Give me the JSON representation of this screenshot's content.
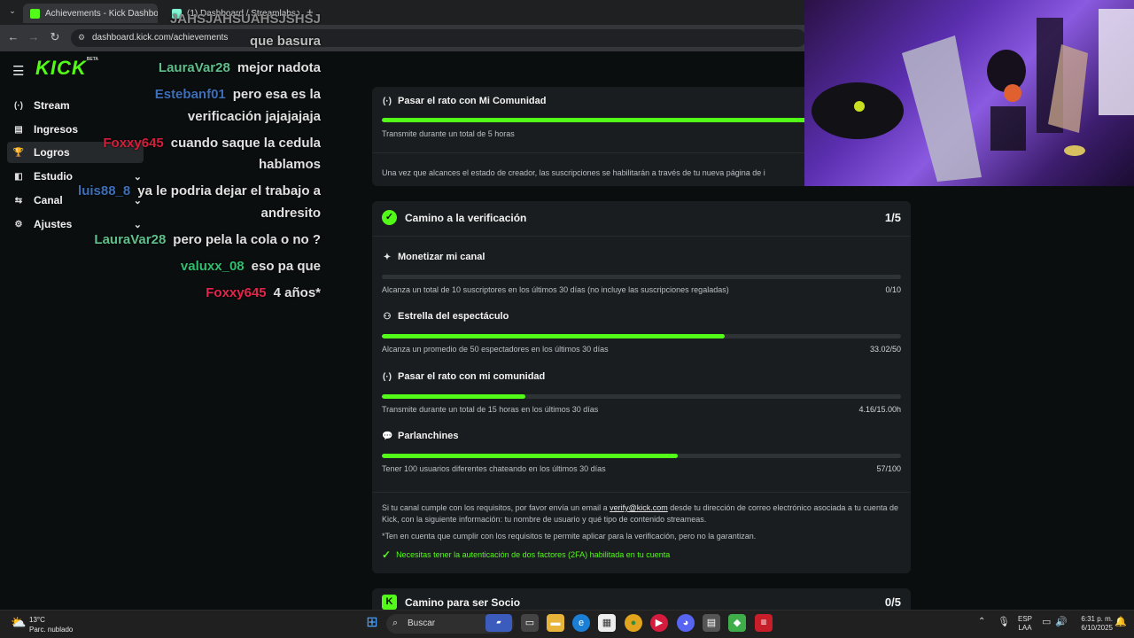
{
  "browser": {
    "tabs": [
      {
        "title": "Achievements - Kick Dashboard",
        "close": "✕"
      },
      {
        "title": "(1) Dashboard / Streamlabs",
        "close": "✕"
      }
    ],
    "new_tab": "+",
    "url": "dashboard.kick.com/achievements",
    "favicon_colors": {
      "kick": "#53fc18",
      "streamlabs": "#80f5d2"
    }
  },
  "sidebar": {
    "logo": "KICK",
    "logo_badge": "BETA",
    "items": [
      {
        "label": "Stream",
        "icon": "broadcast-icon",
        "glyph": "(·)"
      },
      {
        "label": "Ingresos",
        "icon": "wallet-icon",
        "glyph": "▤"
      },
      {
        "label": "Logros",
        "icon": "trophy-icon",
        "glyph": "🏆",
        "active": true
      },
      {
        "label": "Estudio",
        "icon": "studio-icon",
        "glyph": "◧",
        "expandable": true
      },
      {
        "label": "Canal",
        "icon": "channel-icon",
        "glyph": "⇆",
        "expandable": true
      },
      {
        "label": "Ajustes",
        "icon": "gear-icon",
        "glyph": "⚙",
        "expandable": true
      }
    ]
  },
  "chat": {
    "lines": [
      {
        "user": "",
        "msg": "JAHSJAHSUAHSJSHSJ",
        "color": "#8a8a8a"
      },
      {
        "user": "",
        "msg": "que basura",
        "color": "#bdbdbd"
      },
      {
        "user": "LauraVar28",
        "msg": "mejor nadota",
        "color": "#5fbf8a"
      },
      {
        "user": "Estebanf01",
        "msg": "pero esa es la",
        "color": "#3d6fb8"
      },
      {
        "user": "",
        "msg": "verificación jajajajaja",
        "color": "#e0e0e0"
      },
      {
        "user": "Foxxy645",
        "msg": "cuando saque la cedula",
        "color": "#d21f3c"
      },
      {
        "user": "",
        "msg": "hablamos",
        "color": "#e0e0e0"
      },
      {
        "user": "luis88_8",
        "msg": "ya le podria dejar el trabajo a",
        "color": "#3d6fb8"
      },
      {
        "user": "",
        "msg": "andresito",
        "color": "#e0e0e0"
      },
      {
        "user": "LauraVar28",
        "msg": "pero pela la cola o no ?",
        "color": "#5fbf8a"
      },
      {
        "user": "valuxx_08",
        "msg": "eso pa que",
        "color": "#2fbf6f"
      },
      {
        "user": "Foxxy645",
        "msg": "4 años*",
        "color": "#e3264b"
      }
    ]
  },
  "top_card": {
    "title": "Pasar el rato con Mi Comunidad",
    "progress": 1.0,
    "desc": "Transmite durante un total de 5 horas",
    "note": "Una vez que alcances el estado de creador, las suscripciones se habilitarán a través de tu nueva página de i"
  },
  "verification": {
    "title": "Camino a la verificación",
    "count": "1/5",
    "requirements": [
      {
        "title": "Monetizar mi canal",
        "icon": "sparkle-icon",
        "glyph": "✦",
        "progress": 0.0,
        "desc": "Alcanza un total de 10 suscriptores en los últimos 30 días (no incluye las suscripciones regaladas)",
        "value": "0/10"
      },
      {
        "title": "Estrella del espectáculo",
        "icon": "viewers-icon",
        "glyph": "⚇",
        "progress": 0.6604,
        "desc": "Alcanza un promedio de 50 espectadores en los últimos 30 días",
        "value": "33.02/50"
      },
      {
        "title": "Pasar el rato con mi comunidad",
        "icon": "broadcast-icon",
        "glyph": "(·)",
        "progress": 0.2773,
        "desc": "Transmite durante un total de 15 horas en los últimos 30 días",
        "value": "4.16/15.00h"
      },
      {
        "title": "Parlanchines",
        "icon": "chat-bubble-icon",
        "glyph": "💬",
        "progress": 0.57,
        "desc": "Tener 100 usuarios diferentes chateando en los últimos 30 días",
        "value": "57/100"
      }
    ],
    "info_pre": "Si tu canal cumple con los requisitos, por favor envía un email a ",
    "info_email": "verify@kick.com",
    "info_post": " desde tu dirección de correo electrónico asociada a tu cuenta de Kick, con la siguiente información: tu nombre de usuario y qué tipo de contenido streameas.",
    "disclaimer": "*Ten en cuenta que cumplir con los requisitos te permite aplicar para la verificación, pero no la garantizan.",
    "twofa": "Necesitas tener la autenticación de dos factores (2FA) habilitada en tu cuenta"
  },
  "partner": {
    "title": "Camino para ser Socio",
    "count": "0/5"
  },
  "taskbar": {
    "weather_temp": "13°C",
    "weather_desc": "Parc. nublado",
    "search_placeholder": "Buscar",
    "lang_top": "ESP",
    "lang_bottom": "LAA",
    "time": "6:31 p. m.",
    "date": "6/10/2025"
  },
  "colors": {
    "accent": "#53fc18",
    "card": "#191d1f",
    "background": "#0b0e0f"
  }
}
